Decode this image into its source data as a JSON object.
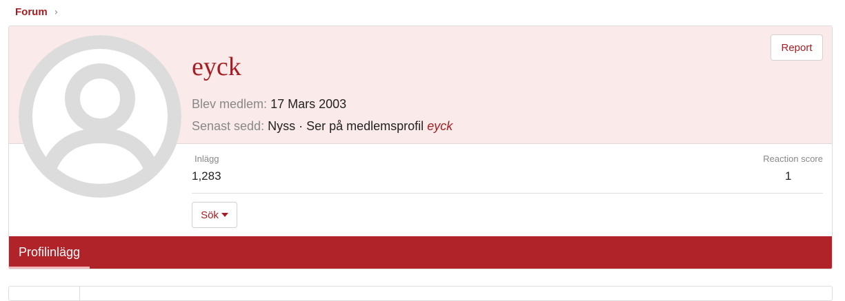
{
  "breadcrumb": {
    "label": "Forum",
    "chevron": "›"
  },
  "profile": {
    "username": "eyck",
    "joined_label": "Blev medlem:",
    "joined_value": "17 Mars 2003",
    "last_seen_label": "Senast sedd:",
    "last_seen_value": "Nyss · Ser på medlemsprofil",
    "last_seen_link": "eyck",
    "report_label": "Report"
  },
  "stats": {
    "posts_label": "Inlägg",
    "posts_value": "1,283",
    "reaction_label": "Reaction score",
    "reaction_value": "1"
  },
  "search_button": {
    "label": "Sök"
  },
  "tabs": [
    {
      "label": "Profilinlägg",
      "active": true
    }
  ],
  "colors": {
    "accent": "#a51d22",
    "tabbar": "#b02328",
    "banner": "#fbeaea"
  }
}
